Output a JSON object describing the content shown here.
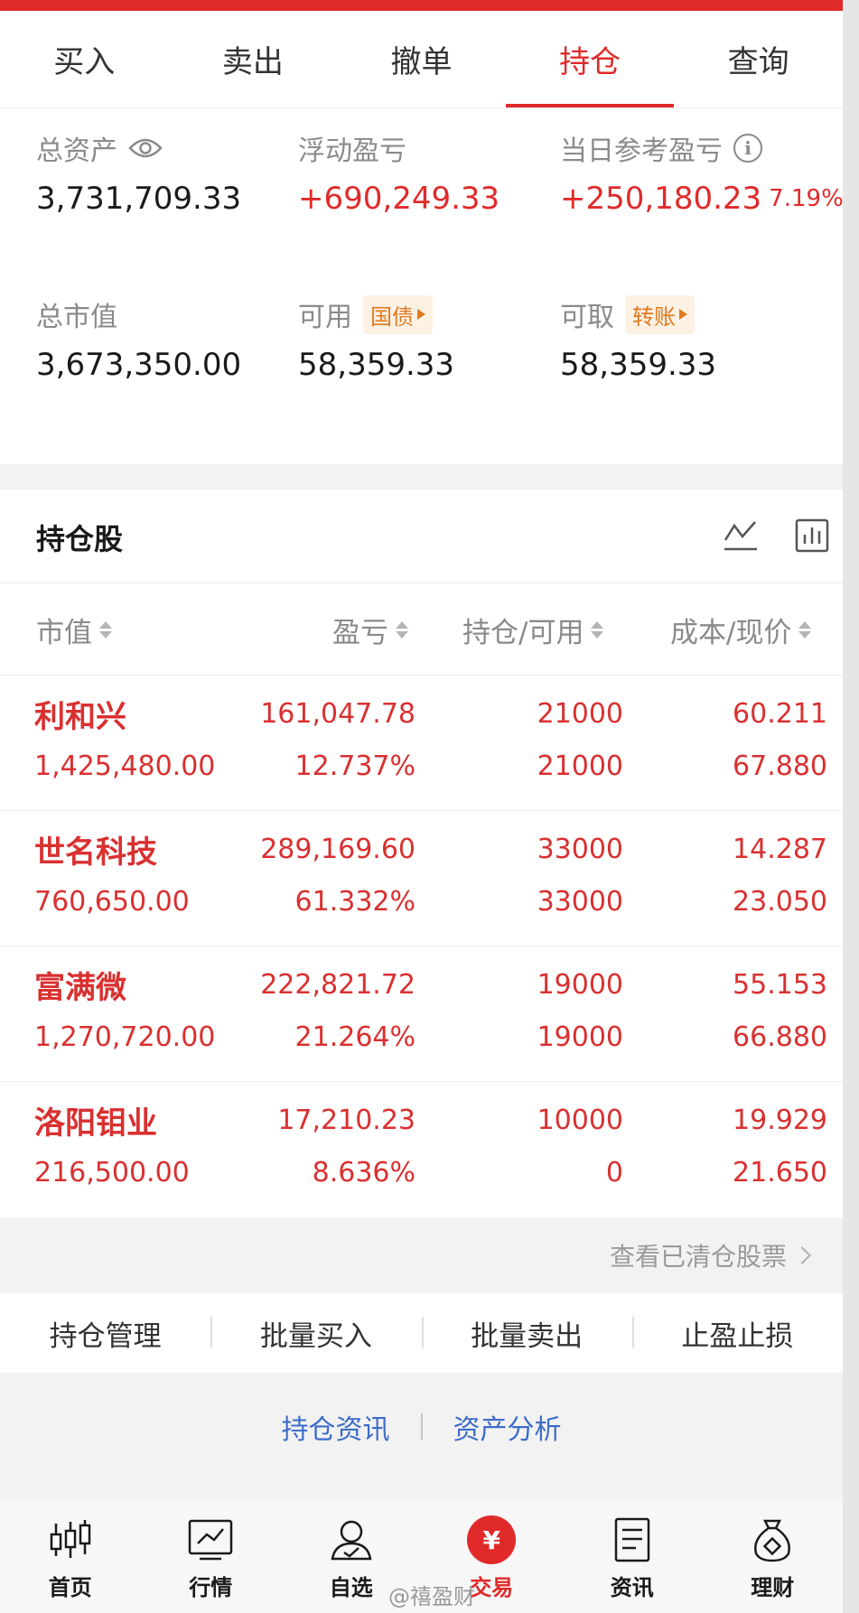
{
  "tabs": [
    "买入",
    "卖出",
    "撤单",
    "持仓",
    "查询"
  ],
  "active_tab": "持仓",
  "assets": {
    "total_assets_label": "总资产",
    "total_assets_value": "3,731,709.33",
    "floating_pl_label": "浮动盈亏",
    "floating_pl_value": "+690,249.33",
    "daily_pl_label": "当日参考盈亏",
    "daily_pl_value": "+250,180.23",
    "daily_pl_pct": "7.19%",
    "market_value_label": "总市值",
    "market_value_value": "3,673,350.00",
    "available_label": "可用",
    "available_tag": "国债",
    "available_value": "58,359.33",
    "withdrawable_label": "可取",
    "withdrawable_tag": "转账",
    "withdrawable_value": "58,359.33"
  },
  "holdings": {
    "title": "持仓股",
    "columns": [
      "市值",
      "盈亏",
      "持仓/可用",
      "成本/现价"
    ],
    "rows": [
      {
        "name": "利和兴",
        "market_value": "1,425,480.00",
        "pl": "161,047.78",
        "pl_pct": "12.737%",
        "position": "21000",
        "available": "21000",
        "cost": "60.211",
        "price": "67.880"
      },
      {
        "name": "世名科技",
        "market_value": "760,650.00",
        "pl": "289,169.60",
        "pl_pct": "61.332%",
        "position": "33000",
        "available": "33000",
        "cost": "14.287",
        "price": "23.050"
      },
      {
        "name": "富满微",
        "market_value": "1,270,720.00",
        "pl": "222,821.72",
        "pl_pct": "21.264%",
        "position": "19000",
        "available": "19000",
        "cost": "55.153",
        "price": "66.880"
      },
      {
        "name": "洛阳钼业",
        "market_value": "216,500.00",
        "pl": "17,210.23",
        "pl_pct": "8.636%",
        "position": "10000",
        "available": "0",
        "cost": "19.929",
        "price": "21.650"
      }
    ]
  },
  "cleared_link": "查看已清仓股票",
  "actions": [
    "持仓管理",
    "批量买入",
    "批量卖出",
    "止盈止损"
  ],
  "info_links": [
    "持仓资讯",
    "资产分析"
  ],
  "nav": [
    {
      "label": "首页",
      "icon": "candlestick-icon"
    },
    {
      "label": "行情",
      "icon": "market-chart-icon"
    },
    {
      "label": "自选",
      "icon": "user-icon"
    },
    {
      "label": "交易",
      "icon": "yen-icon"
    },
    {
      "label": "资讯",
      "icon": "document-icon"
    },
    {
      "label": "理财",
      "icon": "money-bag-icon"
    }
  ],
  "active_nav": "交易",
  "yen_symbol": "¥",
  "watermark": "@禧盈财",
  "colors": {
    "accent": "#e02a2a",
    "link": "#3d6cc9",
    "tag": "#e07a20",
    "muted": "#8a8a8a"
  }
}
